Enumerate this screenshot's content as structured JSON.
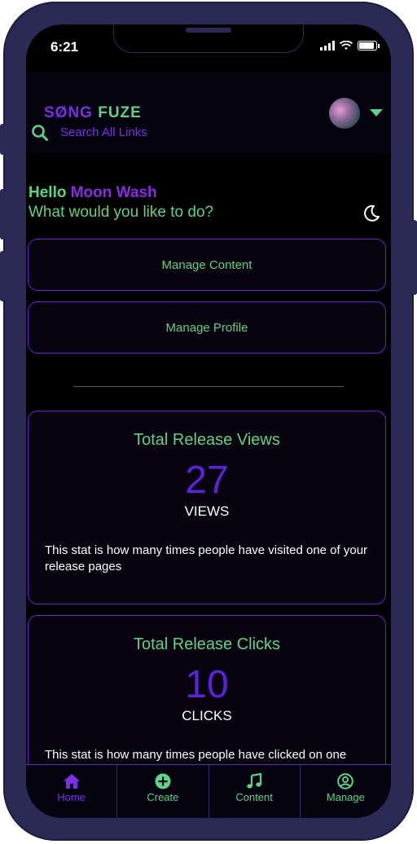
{
  "status_bar": {
    "time": "6:21"
  },
  "header": {
    "logo_part1": "SØNG",
    "logo_part2": "FUZE",
    "search_placeholder": "Search All Links"
  },
  "greeting": {
    "hello": "Hello",
    "user_name": "Moon Wash",
    "question": "What would you like to do?"
  },
  "actions": {
    "manage_content": "Manage Content",
    "manage_profile": "Manage Profile"
  },
  "stats": [
    {
      "title": "Total Release Views",
      "value": "27",
      "unit": "VIEWS",
      "description": "This stat is how many times people have visited one of your release pages"
    },
    {
      "title": "Total Release Clicks",
      "value": "10",
      "unit": "CLICKS",
      "description": "This stat is how many times people have clicked on one"
    }
  ],
  "tabs": [
    {
      "label": "Home",
      "icon": "home-icon",
      "active": true
    },
    {
      "label": "Create",
      "icon": "plus-circle-icon",
      "active": false
    },
    {
      "label": "Content",
      "icon": "music-note-icon",
      "active": false
    },
    {
      "label": "Manage",
      "icon": "user-circle-icon",
      "active": false
    }
  ],
  "colors": {
    "accent_purple": "#7b2ee6",
    "accent_green": "#5fd18a",
    "frame": "#2b2a55",
    "background": "#000000"
  }
}
